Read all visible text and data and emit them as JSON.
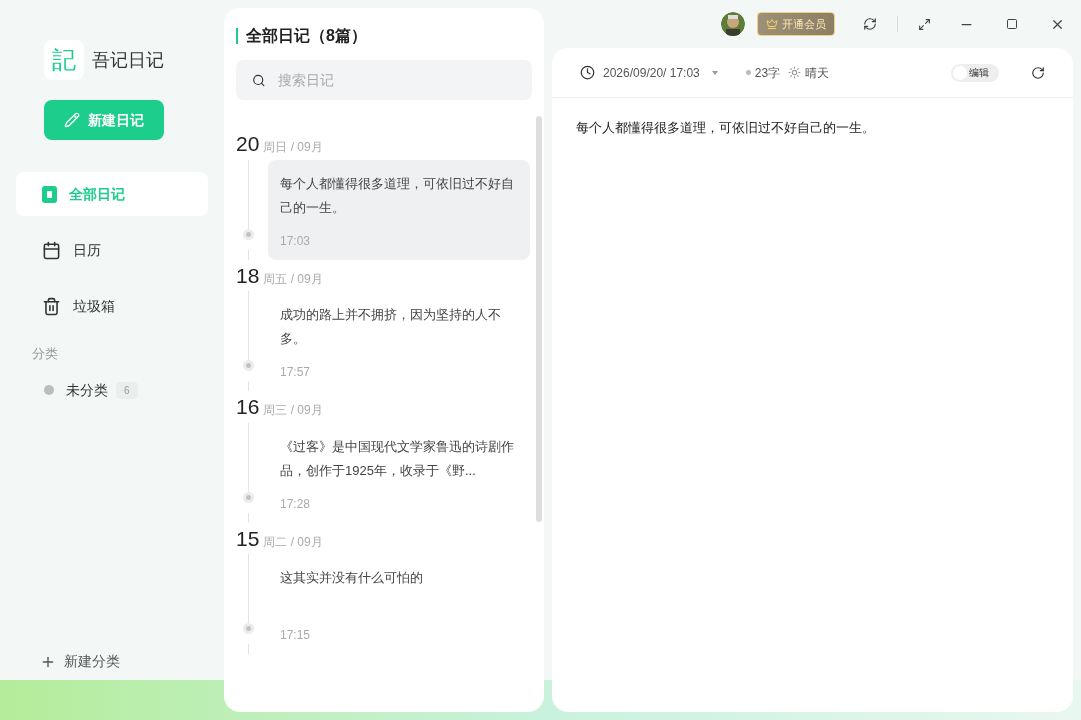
{
  "app": {
    "logo": "記",
    "name": "吾记日记"
  },
  "new_button": "新建日记",
  "nav": [
    {
      "kind": "book",
      "label": "全部日记",
      "selected": true
    },
    {
      "kind": "calendar",
      "label": "日历",
      "selected": false
    },
    {
      "kind": "trash",
      "label": "垃圾箱",
      "selected": false
    }
  ],
  "categories": {
    "title": "分类",
    "items": [
      {
        "label": "未分类",
        "count": "6",
        "color": "#bdbdbd"
      }
    ],
    "add": "新建分类"
  },
  "list": {
    "title": "全部日记（8篇）",
    "search": {
      "placeholder": "搜索日记"
    },
    "entries": [
      {
        "day": "20",
        "meta": "周日 / 09月",
        "text": "每个人都懂得很多道理，可依旧过不好自己的一生。",
        "time": "17:03",
        "selected": true
      },
      {
        "day": "18",
        "meta": "周五 / 09月",
        "text": "成功的路上并不拥挤，因为坚持的人不多。",
        "time": "17:57",
        "selected": false
      },
      {
        "day": "16",
        "meta": "周三 / 09月",
        "text": "《过客》是中国现代文学家鲁迅的诗剧作品，创作于1925年，收录于《野...",
        "time": "17:28",
        "selected": false
      },
      {
        "day": "15",
        "meta": "周二 / 09月",
        "text": "这其实并没有什么可怕的",
        "time": "17:15",
        "selected": false
      }
    ]
  },
  "topbar": {
    "vip": "开通会员"
  },
  "editor": {
    "datetime": "2026/09/20/ 17:03",
    "words": "23字",
    "weather": "晴天",
    "toggle": {
      "label": "编辑",
      "on": false
    },
    "content": "每个人都懂得很多道理，可依旧过不好自己的一生。"
  }
}
